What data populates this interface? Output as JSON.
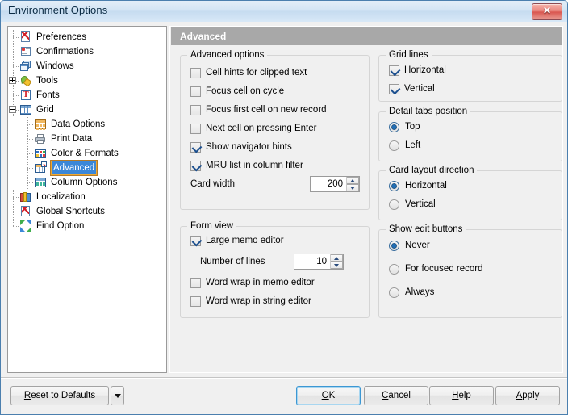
{
  "window": {
    "title": "Environment Options",
    "close_label": "✕"
  },
  "sidebar": {
    "items": [
      {
        "label": "Preferences",
        "icon": "preferences-icon",
        "indent": 0,
        "expander": "none"
      },
      {
        "label": "Confirmations",
        "icon": "confirmations-icon",
        "indent": 0,
        "expander": "none"
      },
      {
        "label": "Windows",
        "icon": "windows-icon",
        "indent": 0,
        "expander": "none"
      },
      {
        "label": "Tools",
        "icon": "tools-icon",
        "indent": 0,
        "expander": "plus"
      },
      {
        "label": "Fonts",
        "icon": "fonts-icon",
        "indent": 0,
        "expander": "none"
      },
      {
        "label": "Grid",
        "icon": "grid-icon",
        "indent": 0,
        "expander": "minus"
      },
      {
        "label": "Data Options",
        "icon": "data-options-icon",
        "indent": 1,
        "expander": "none"
      },
      {
        "label": "Print Data",
        "icon": "print-data-icon",
        "indent": 1,
        "expander": "none"
      },
      {
        "label": "Color & Formats",
        "icon": "color-formats-icon",
        "indent": 1,
        "expander": "none"
      },
      {
        "label": "Advanced",
        "icon": "advanced-icon",
        "indent": 1,
        "expander": "none",
        "selected": true
      },
      {
        "label": "Column Options",
        "icon": "column-options-icon",
        "indent": 1,
        "expander": "none"
      },
      {
        "label": "Localization",
        "icon": "localization-icon",
        "indent": 0,
        "expander": "none"
      },
      {
        "label": "Global Shortcuts",
        "icon": "global-shortcuts-icon",
        "indent": 0,
        "expander": "none"
      },
      {
        "label": "Find Option",
        "icon": "find-option-icon",
        "indent": 0,
        "expander": "none"
      }
    ]
  },
  "page": {
    "header": "Advanced"
  },
  "advanced_options": {
    "title": "Advanced options",
    "checkboxes": [
      {
        "label": "Cell hints for clipped text",
        "checked": false
      },
      {
        "label": "Focus cell on cycle",
        "checked": false
      },
      {
        "label": "Focus first cell on new record",
        "checked": false
      },
      {
        "label": "Next cell on pressing Enter",
        "checked": false
      },
      {
        "label": "Show navigator hints",
        "checked": true
      },
      {
        "label": "MRU list in column filter",
        "checked": true
      }
    ],
    "card_width_label": "Card width",
    "card_width_value": "200"
  },
  "form_view": {
    "title": "Form view",
    "large_memo_editor": {
      "label": "Large memo editor",
      "checked": true
    },
    "number_of_lines_label": "Number of lines",
    "number_of_lines_value": "10",
    "checkboxes": [
      {
        "label": "Word wrap in memo editor",
        "checked": false
      },
      {
        "label": "Word wrap in string editor",
        "checked": false
      }
    ]
  },
  "grid_lines": {
    "title": "Grid lines",
    "checkboxes": [
      {
        "label": "Horizontal",
        "checked": true
      },
      {
        "label": "Vertical",
        "checked": true
      }
    ]
  },
  "detail_tabs_position": {
    "title": "Detail tabs position",
    "options": [
      {
        "label": "Top",
        "selected": true
      },
      {
        "label": "Left",
        "selected": false
      }
    ]
  },
  "card_layout_direction": {
    "title": "Card layout direction",
    "options": [
      {
        "label": "Horizontal",
        "selected": true
      },
      {
        "label": "Vertical",
        "selected": false
      }
    ]
  },
  "show_edit_buttons": {
    "title": "Show edit buttons",
    "options": [
      {
        "label": "Never",
        "selected": true
      },
      {
        "label": "For focused record",
        "selected": false
      },
      {
        "label": "Always",
        "selected": false
      }
    ]
  },
  "footer": {
    "reset": {
      "pre": "",
      "acc": "R",
      "post": "eset to Defaults"
    },
    "ok": {
      "pre": "",
      "acc": "O",
      "post": "K"
    },
    "cancel": {
      "pre": "",
      "acc": "C",
      "post": "ancel"
    },
    "help": {
      "pre": "",
      "acc": "H",
      "post": "elp"
    },
    "apply": {
      "pre": "",
      "acc": "A",
      "post": "pply"
    }
  },
  "colors": {
    "accent": "#3b87d8",
    "header_bar": "#a8a8a8",
    "title_bar": "#cfe2f3",
    "close_button": "#d9564f",
    "selection": "#3b87d8"
  }
}
